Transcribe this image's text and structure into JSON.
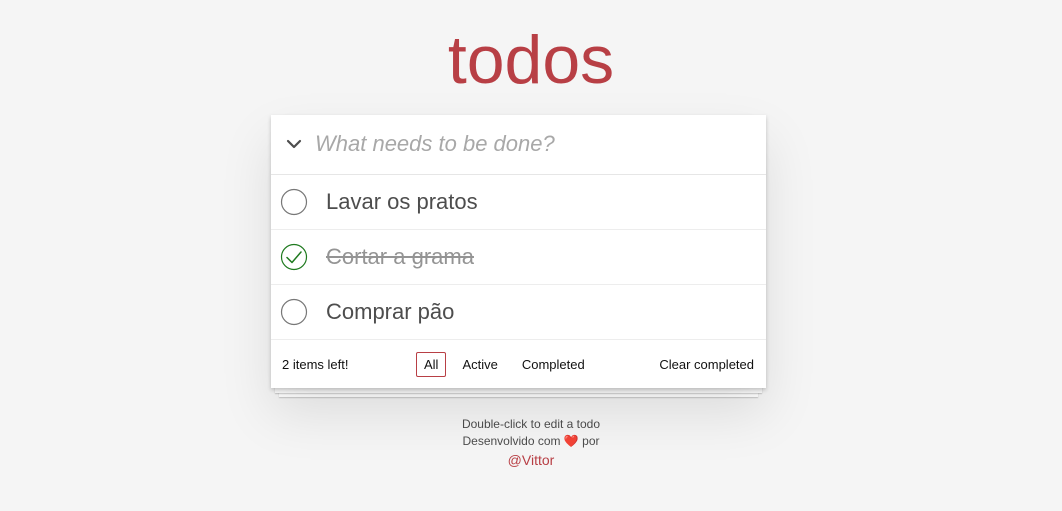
{
  "header": {
    "title": "todos"
  },
  "new_todo": {
    "placeholder": "What needs to be done?"
  },
  "todos": [
    {
      "label": "Lavar os pratos",
      "completed": false
    },
    {
      "label": "Cortar a grama",
      "completed": true
    },
    {
      "label": "Comprar pão",
      "completed": false
    }
  ],
  "footer": {
    "count_text": "2 items left!",
    "filters": [
      {
        "label": "All",
        "selected": true
      },
      {
        "label": "Active",
        "selected": false
      },
      {
        "label": "Completed",
        "selected": false
      }
    ],
    "clear_label": "Clear completed"
  },
  "info": {
    "hint": "Double-click to edit a todo",
    "credit_prefix": "Desenvolvido com",
    "heart": "❤️",
    "credit_suffix": "por",
    "author": "@Vittor"
  },
  "colors": {
    "brand": "#b83f45",
    "check": "#3ea390",
    "background": "#f5f5f5"
  },
  "icons": {
    "toggle_all": "chevron-down-icon",
    "unchecked": "circle-icon",
    "checked": "check-circle-icon"
  }
}
